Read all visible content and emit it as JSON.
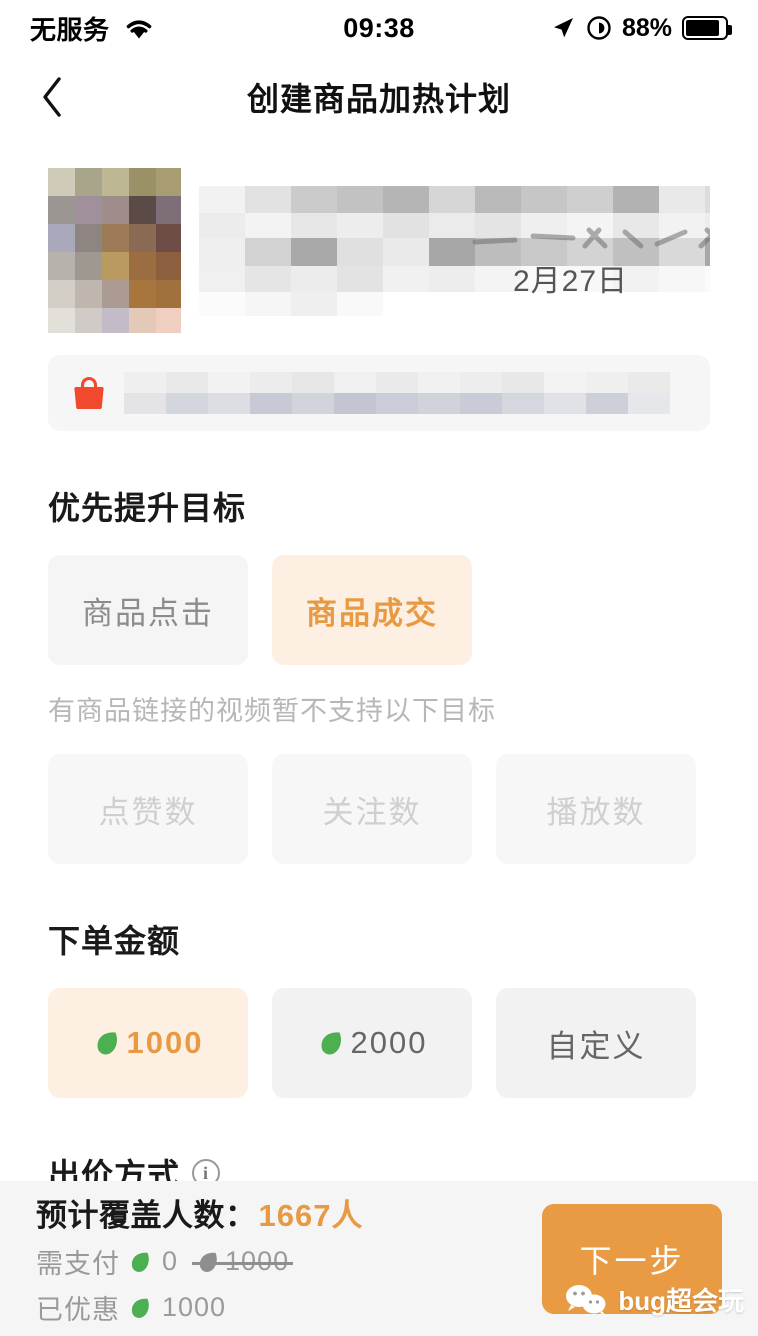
{
  "statusbar": {
    "carrier": "无服务",
    "wifi_icon": "wifi-icon",
    "time": "09:38",
    "location_icon": "location-arrow-icon",
    "orientation_icon": "rotation-lock-icon",
    "battery_percent": "88%",
    "battery_icon": "battery-icon"
  },
  "navbar": {
    "back_icon": "chevron-left-icon",
    "title": "创建商品加热计划"
  },
  "video_card": {
    "thumbnail": "video-thumbnail-censored",
    "title_censored": "",
    "date": "2月27日"
  },
  "product_link": {
    "icon": "shopping-bag-icon",
    "text_censored": ""
  },
  "goal_section": {
    "title": "优先提升目标",
    "options": [
      {
        "label": "商品点击",
        "state": "unselected"
      },
      {
        "label": "商品成交",
        "state": "selected"
      }
    ],
    "hint": "有商品链接的视频暂不支持以下目标",
    "disabled_options": [
      {
        "label": "点赞数",
        "state": "disabled"
      },
      {
        "label": "关注数",
        "state": "disabled"
      },
      {
        "label": "播放数",
        "state": "disabled"
      }
    ]
  },
  "amount_section": {
    "title": "下单金额",
    "options": [
      {
        "label": "1000",
        "icon": "dou-coin-icon",
        "state": "selected"
      },
      {
        "label": "2000",
        "icon": "dou-coin-icon",
        "state": "unselected"
      },
      {
        "label": "自定义",
        "icon": "",
        "state": "unselected"
      }
    ]
  },
  "bid_section": {
    "title": "出价方式",
    "info_icon": "info-icon",
    "info_glyph": "i"
  },
  "bottombar": {
    "reach_label": "预计覆盖人数：",
    "reach_value": "1667人",
    "pay_label": "需支付",
    "pay_value": "0",
    "pay_original": "1000",
    "discount_label": "已优惠",
    "discount_value": "1000",
    "next_label": "下一步"
  },
  "watermark": {
    "text": "bug超会玩",
    "icon": "wechat-icon"
  },
  "colors": {
    "accent_orange": "#e89a43",
    "selected_chip_bg": "#fdf0e2",
    "chip_bg": "#f5f5f5",
    "coin_green": "#4caf50",
    "bag_red": "#f0492e",
    "bottom_bar_bg": "#f5f5f5"
  }
}
